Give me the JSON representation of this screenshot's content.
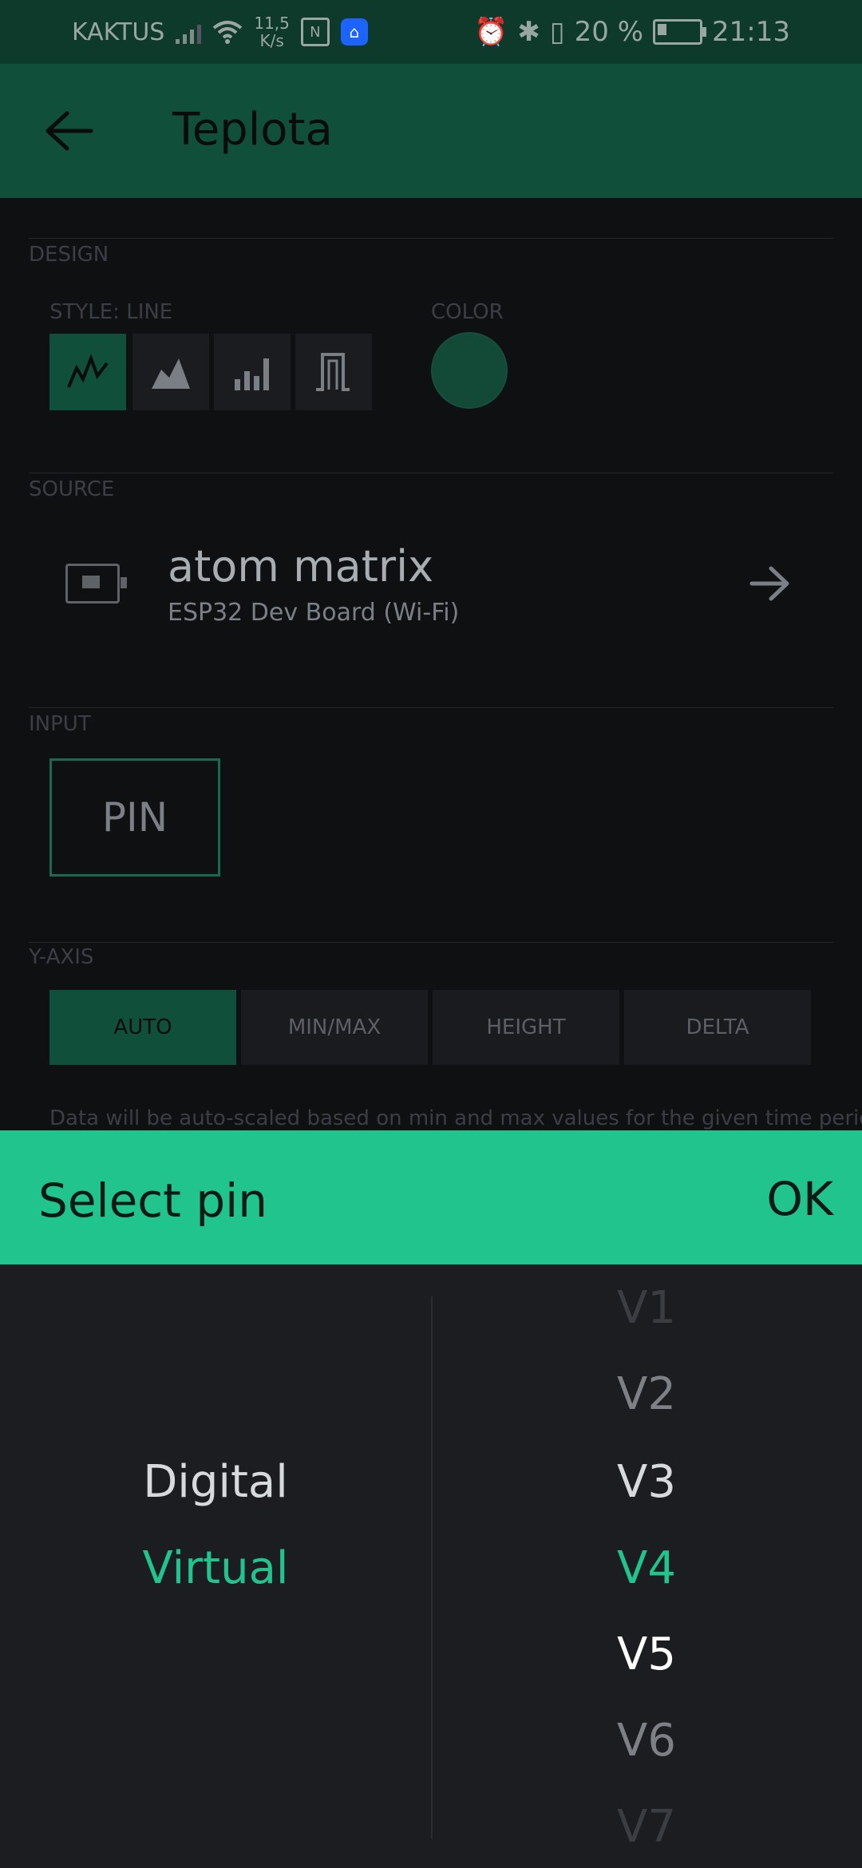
{
  "status_bar": {
    "carrier": "KAKTUS",
    "net_speed": "11,5\nK/s",
    "battery_percent": "20 %",
    "time": "21:13"
  },
  "app_bar": {
    "title": "Teplota"
  },
  "design": {
    "section_label": "DESIGN",
    "style_label": "STYLE: LINE",
    "color_label": "COLOR",
    "color_value": "#124a37",
    "styles": [
      {
        "icon": "line-chart-icon",
        "active": true
      },
      {
        "icon": "area-chart-icon",
        "active": false
      },
      {
        "icon": "bar-chart-icon",
        "active": false
      },
      {
        "icon": "binary-chart-icon",
        "active": false
      }
    ]
  },
  "source": {
    "section_label": "SOURCE",
    "device_name": "atom matrix",
    "device_board": "ESP32 Dev Board (Wi-Fi)"
  },
  "input": {
    "section_label": "INPUT",
    "pin_label": "PIN"
  },
  "y_axis": {
    "section_label": "Y-AXIS",
    "options": [
      "AUTO",
      "MIN/MAX",
      "HEIGHT",
      "DELTA"
    ],
    "selected": "AUTO",
    "hint": "Data will be auto-scaled based on min and max values for the given time period"
  },
  "dialog": {
    "title": "Select pin",
    "ok_label": "OK",
    "pin_types": [
      "Digital",
      "Virtual"
    ],
    "selected_type": "Virtual",
    "pins": [
      "V1",
      "V2",
      "V3",
      "V4",
      "V5",
      "V6",
      "V7"
    ],
    "selected_pin": "V4",
    "accent_color": "#22c48e"
  }
}
